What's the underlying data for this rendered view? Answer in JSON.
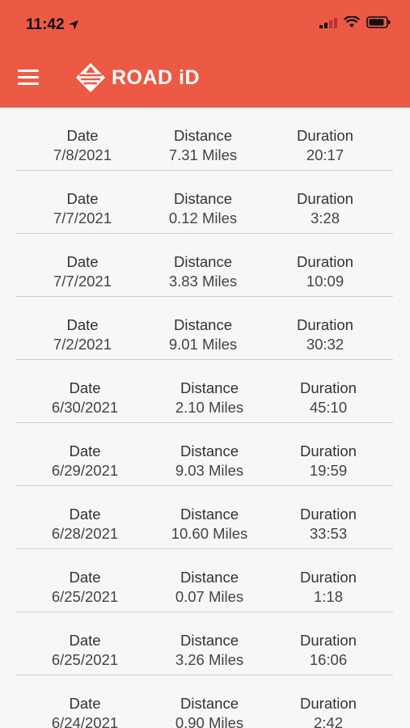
{
  "status": {
    "time": "11:42"
  },
  "app": {
    "logo_text": "ROAD iD",
    "brand_color": "#ec5a45"
  },
  "labels": {
    "date": "Date",
    "distance": "Distance",
    "duration": "Duration"
  },
  "rows": [
    {
      "date": "7/8/2021",
      "distance": "7.31 Miles",
      "duration": "20:17"
    },
    {
      "date": "7/7/2021",
      "distance": "0.12 Miles",
      "duration": "3:28"
    },
    {
      "date": "7/7/2021",
      "distance": "3.83 Miles",
      "duration": "10:09"
    },
    {
      "date": "7/2/2021",
      "distance": "9.01 Miles",
      "duration": "30:32"
    },
    {
      "date": "6/30/2021",
      "distance": "2.10 Miles",
      "duration": "45:10"
    },
    {
      "date": "6/29/2021",
      "distance": "9.03 Miles",
      "duration": "19:59"
    },
    {
      "date": "6/28/2021",
      "distance": "10.60 Miles",
      "duration": "33:53"
    },
    {
      "date": "6/25/2021",
      "distance": "0.07 Miles",
      "duration": "1:18"
    },
    {
      "date": "6/25/2021",
      "distance": "3.26 Miles",
      "duration": "16:06"
    },
    {
      "date": "6/24/2021",
      "distance": "0.90 Miles",
      "duration": "2:42"
    }
  ]
}
